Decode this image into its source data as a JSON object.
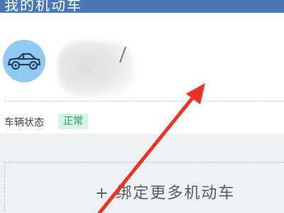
{
  "header": {
    "title": "我的机动车"
  },
  "vehicle": {
    "icon": "car-icon",
    "plate": "",
    "status_label": "车辆状态",
    "status_value": "正常"
  },
  "actions": {
    "bind_more": "+ 绑定更多机动车"
  },
  "colors": {
    "header_bg": "#4a78b5",
    "avatar_bg": "#90caf3",
    "status_green": "#1aa85a",
    "arrow_red": "#ea3323"
  }
}
